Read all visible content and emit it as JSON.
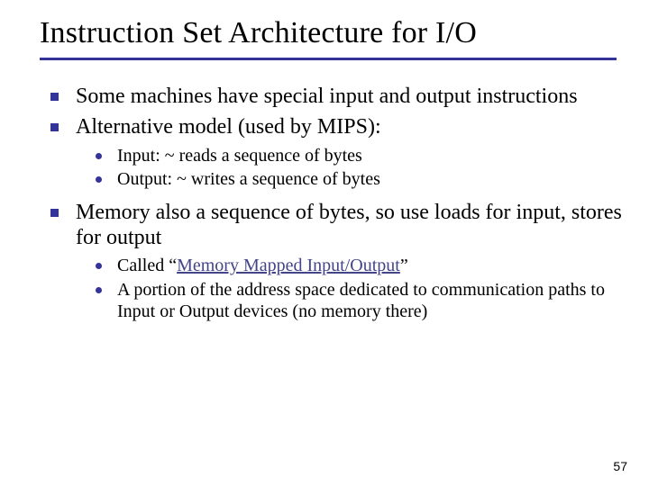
{
  "title": "Instruction Set Architecture for I/O",
  "bullets": {
    "b1": "Some machines have special input and output instructions",
    "b2": "Alternative model (used by MIPS):",
    "b2_sub": {
      "s1": "Input:    ~ reads a sequence of bytes",
      "s2": "Output: ~ writes a sequence of bytes"
    },
    "b3": "Memory also a sequence of bytes, so use loads for input, stores for output",
    "b3_sub": {
      "s1_pre": "Called “",
      "s1_link": "Memory Mapped Input/Output",
      "s1_post": "”",
      "s2": "A portion of the address space dedicated to communication paths to Input or Output devices (no memory there)"
    }
  },
  "page_number": "57"
}
